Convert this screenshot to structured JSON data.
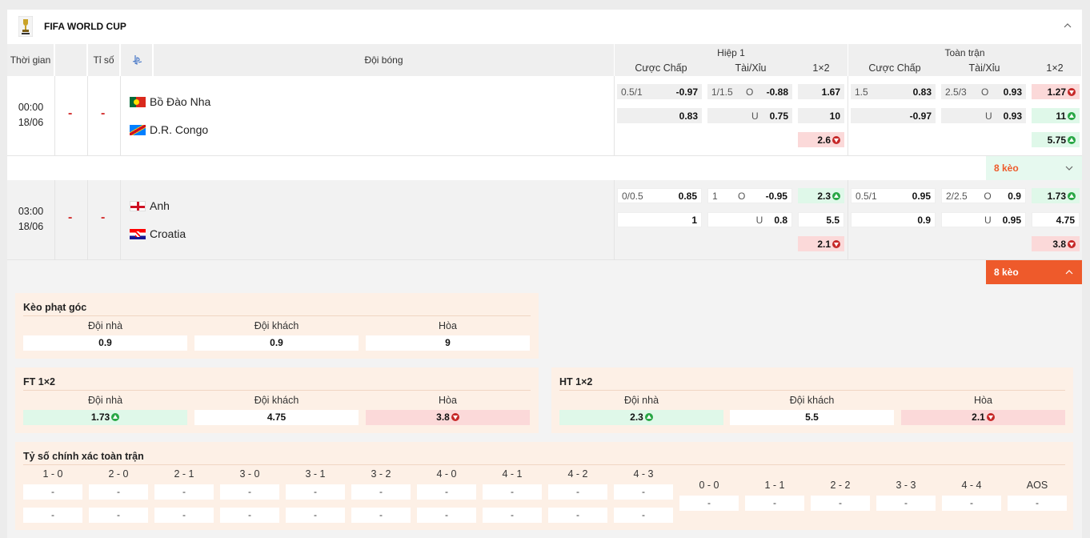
{
  "league": {
    "name": "FIFA WORLD CUP"
  },
  "headers": {
    "time": "Thời gian",
    "score": "Tỉ số",
    "team": "Đội bóng",
    "half1": "Hiệp 1",
    "full": "Toàn trận",
    "handicap": "Cược Chấp",
    "overunder": "Tài/Xỉu",
    "onextwo": "1×2"
  },
  "matches": [
    {
      "time": "00:00",
      "date": "18/06",
      "score_home": "-",
      "score_away": "-",
      "home": "Bồ Đào Nha",
      "away": "D.R. Congo",
      "h1": {
        "hdp_line": "0.5/1",
        "hdp_home": "-0.97",
        "hdp_away": "0.83",
        "ou_line": "1/1.5",
        "ou_o_label": "O",
        "ou_over": "-0.88",
        "ou_u_label": "U",
        "ou_under": "0.75",
        "x_1": "1.67",
        "x_2": "10",
        "x_x": "2.6"
      },
      "ft": {
        "hdp_line": "1.5",
        "hdp_home": "0.83",
        "hdp_away": "-0.97",
        "ou_line": "2.5/3",
        "ou_o_label": "O",
        "ou_over": "0.93",
        "ou_u_label": "U",
        "ou_under": "0.93",
        "x_1": "1.27",
        "x_2": "11",
        "x_x": "5.75"
      },
      "more": "8 kèo"
    },
    {
      "time": "03:00",
      "date": "18/06",
      "score_home": "-",
      "score_away": "-",
      "home": "Anh",
      "away": "Croatia",
      "h1": {
        "hdp_line": "0/0.5",
        "hdp_home": "0.85",
        "hdp_away": "1",
        "ou_line": "1",
        "ou_o_label": "O",
        "ou_over": "-0.95",
        "ou_u_label": "U",
        "ou_under": "0.8",
        "x_1": "2.3",
        "x_2": "5.5",
        "x_x": "2.1"
      },
      "ft": {
        "hdp_line": "0.5/1",
        "hdp_home": "0.95",
        "hdp_away": "0.9",
        "ou_line": "2/2.5",
        "ou_o_label": "O",
        "ou_over": "0.9",
        "ou_u_label": "U",
        "ou_under": "0.95",
        "x_1": "1.73",
        "x_2": "4.75",
        "x_x": "3.8"
      },
      "more": "8 kèo"
    }
  ],
  "corner": {
    "title": "Kèo phạt góc",
    "home_label": "Đội nhà",
    "away_label": "Đội khách",
    "draw_label": "Hòa",
    "home": "0.9",
    "away": "0.9",
    "draw": "9"
  },
  "ft1x2": {
    "title": "FT 1×2",
    "home_label": "Đội nhà",
    "away_label": "Đội khách",
    "draw_label": "Hòa",
    "home": "1.73",
    "away": "4.75",
    "draw": "3.8"
  },
  "ht1x2": {
    "title": "HT 1×2",
    "home_label": "Đội nhà",
    "away_label": "Đội khách",
    "draw_label": "Hòa",
    "home": "2.3",
    "away": "5.5",
    "draw": "2.1"
  },
  "correct_score": {
    "title": "Tỷ số chính xác toàn trận",
    "cols": [
      "1 - 0",
      "2 - 0",
      "2 - 1",
      "3 - 0",
      "3 - 1",
      "3 - 2",
      "4 - 0",
      "4 - 1",
      "4 - 2",
      "4 - 3"
    ],
    "draws": [
      "0 - 0",
      "1 - 1",
      "2 - 2",
      "3 - 3",
      "4 - 4",
      "AOS"
    ],
    "empty": "-"
  },
  "colors": {
    "accent": "#ee5a2b",
    "up": "#dff8e9",
    "down": "#fbd9d9",
    "panel": "#fdf0e6"
  }
}
